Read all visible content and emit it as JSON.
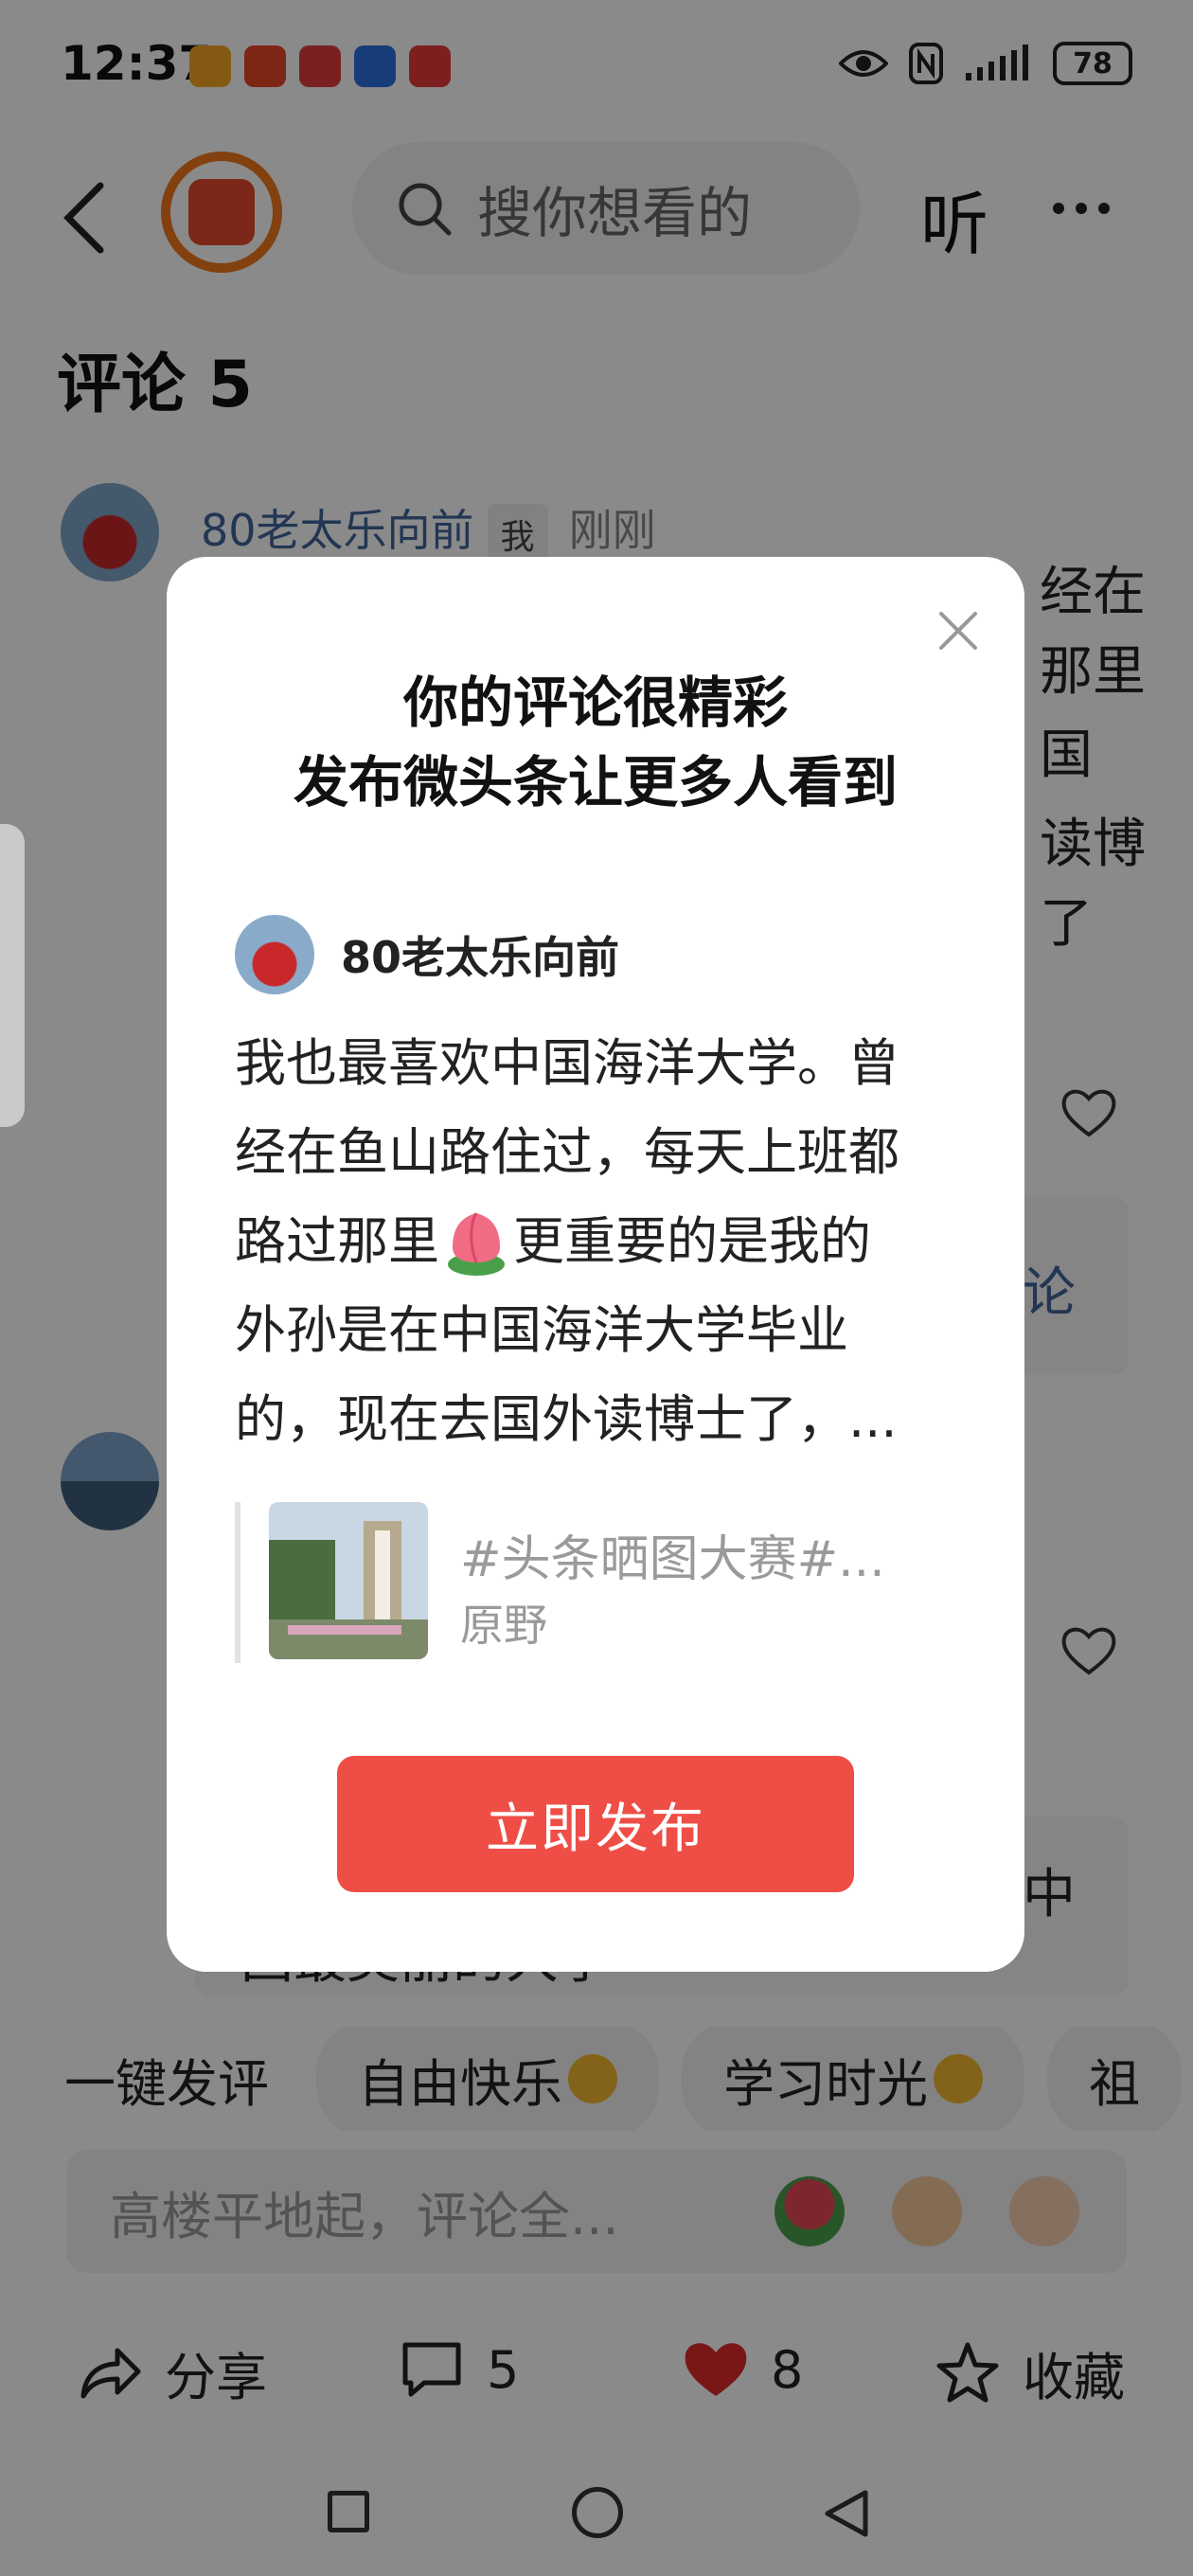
{
  "status_bar": {
    "time": "12:37",
    "battery": "78"
  },
  "header": {
    "search_placeholder": "搜你想看的",
    "listen_label": "听"
  },
  "comments_section": {
    "title": "评论 5",
    "first_comment": {
      "author": "80老太乐向前",
      "me_badge": "我",
      "time": "刚刚",
      "visible_fragments": [
        "经在",
        "那里",
        "国",
        "读博",
        "了"
      ]
    },
    "reply_link_fragment": "论",
    "second_reply_fragment": "中",
    "second_text_fragment": "国最美丽的大学"
  },
  "quick_comments": {
    "lead": "一键发评",
    "chips": [
      "自由快乐",
      "学习时光",
      "祖"
    ]
  },
  "comment_input": {
    "placeholder": "高楼平地起，评论全..."
  },
  "action_bar": {
    "share_label": "分享",
    "comment_count": "5",
    "like_count": "8",
    "favorite_label": "收藏"
  },
  "modal": {
    "title_line1": "你的评论很精彩",
    "title_line2": "发布微头条让更多人看到",
    "author_name": "80老太乐向前",
    "comment_lines": [
      "我也最喜欢中国海洋大学。曾",
      "经在鱼山路住过，每天上班都",
      "路过那里",
      "更重要的是我的",
      "外孙是在中国海洋大学毕业",
      "的，现在去国外读博士了，..."
    ],
    "quote_title": "#头条晒图大赛#...",
    "quote_author": "原野",
    "publish_label": "立即发布"
  },
  "colors": {
    "accent_red": "#ee4e45",
    "link_blue": "#406599"
  }
}
